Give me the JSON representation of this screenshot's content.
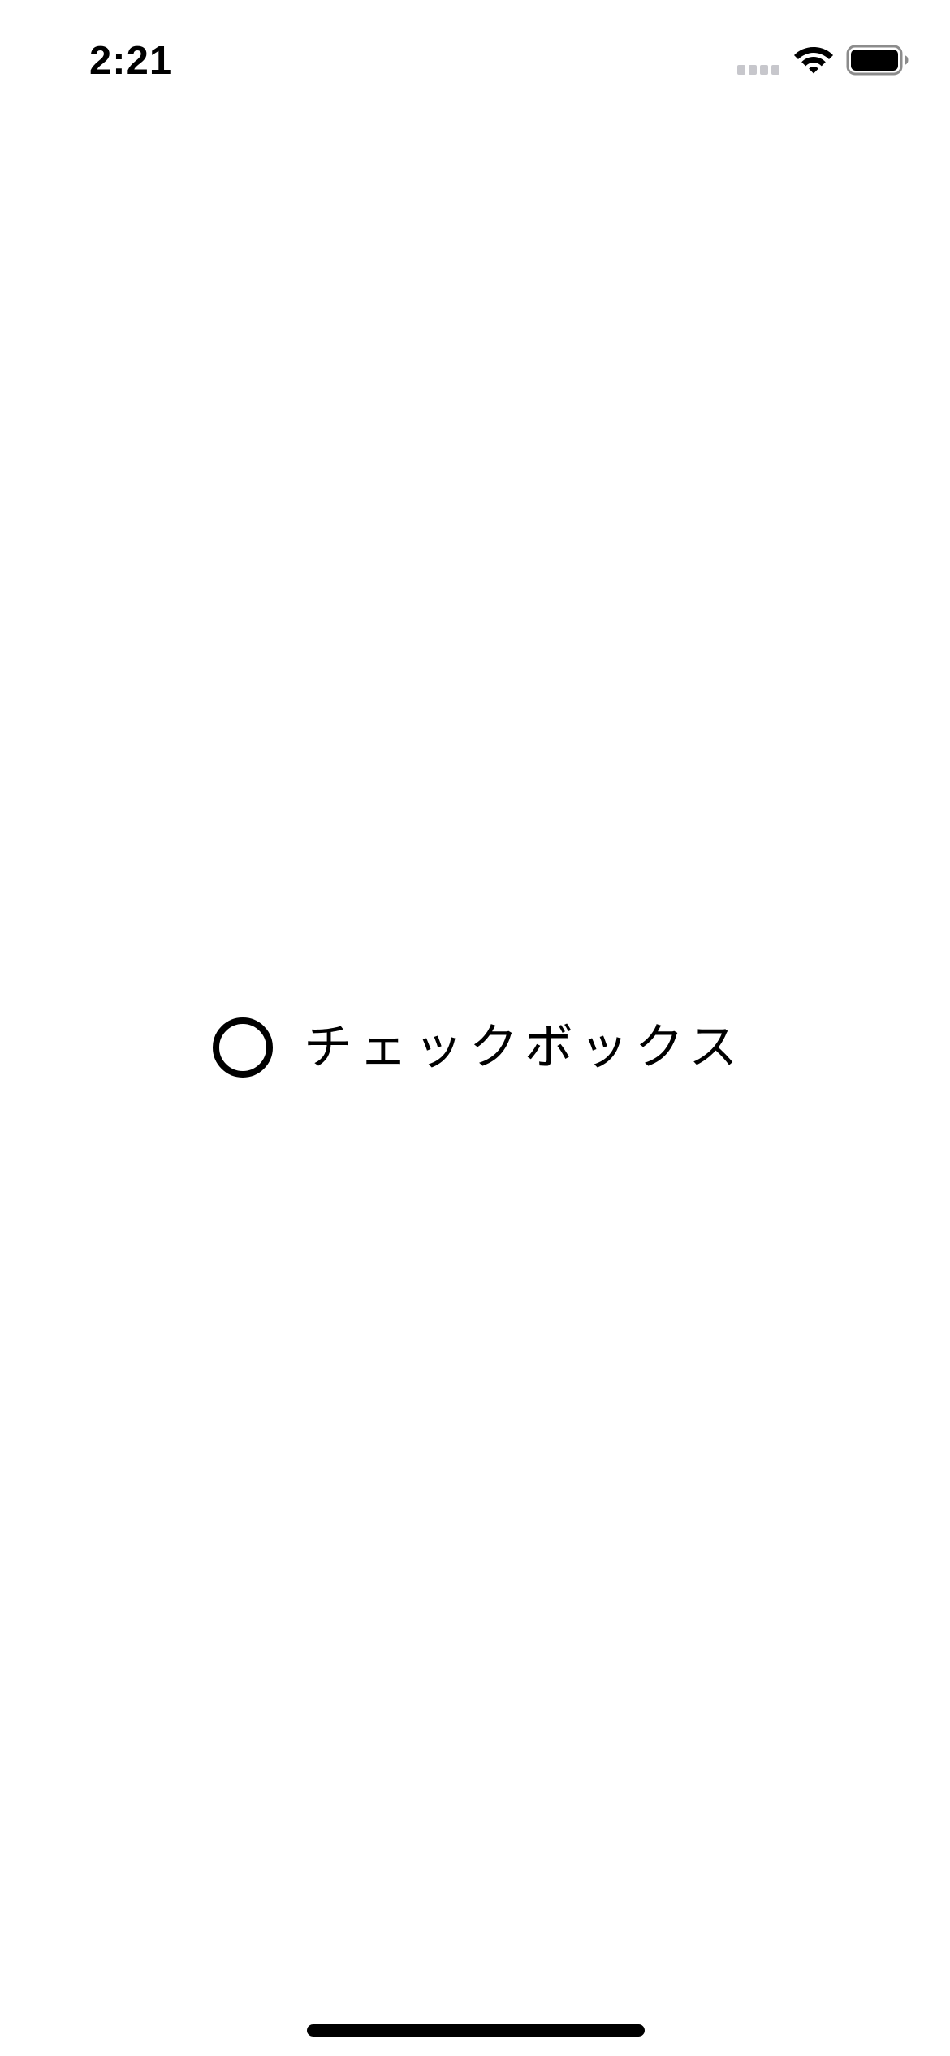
{
  "status_bar": {
    "time": "2:21",
    "icons": [
      "signal-icon",
      "wifi-icon",
      "battery-icon"
    ]
  },
  "checkbox": {
    "label": "チェックボックス",
    "checked": false
  },
  "colors": {
    "background": "#ffffff",
    "foreground": "#000000",
    "inactive_signal": "#c7c7cc"
  }
}
